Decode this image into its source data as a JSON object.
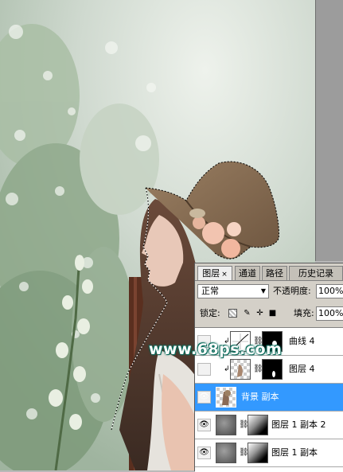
{
  "panel": {
    "tabs": [
      {
        "label": "图层",
        "close": "×",
        "active": true
      },
      {
        "label": "通道",
        "active": false
      },
      {
        "label": "路径",
        "active": false
      },
      {
        "label": "历史记录",
        "active": false
      }
    ],
    "blend_mode": "正常",
    "opacity_label": "不透明度:",
    "opacity_value": "100%",
    "lock_label": "锁定:",
    "fill_label": "填充:",
    "fill_value": "100%",
    "layers": [
      {
        "name": "曲线 4",
        "visible": false,
        "selected": false
      },
      {
        "name": "图层 4",
        "visible": false,
        "selected": false
      },
      {
        "name": "背景 副本",
        "visible": true,
        "selected": true
      },
      {
        "name": "图层 1 副本 2",
        "visible": true,
        "selected": false
      },
      {
        "name": "图层 1 副本",
        "visible": true,
        "selected": false
      }
    ]
  },
  "watermark": "www.68ps.com"
}
